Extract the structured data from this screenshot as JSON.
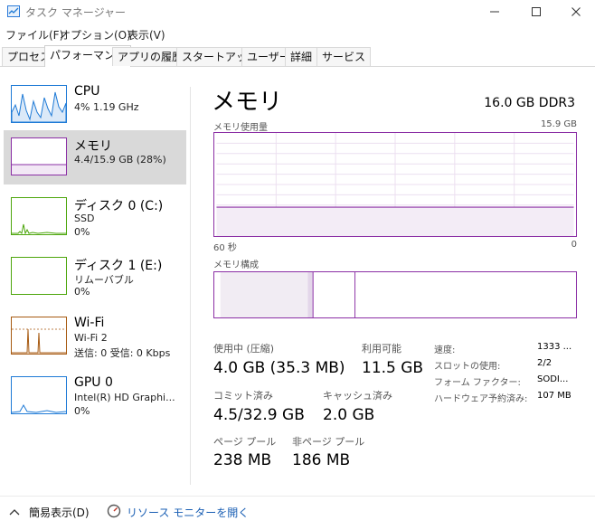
{
  "window": {
    "title": "タスク マネージャー"
  },
  "menu": [
    "ファイル(F)",
    "オプション(O)",
    "表示(V)"
  ],
  "tabs": [
    {
      "label": "プロセス",
      "active": false
    },
    {
      "label": "パフォーマンス",
      "active": true
    },
    {
      "label": "アプリの履歴",
      "active": false
    },
    {
      "label": "スタートアップ",
      "active": false
    },
    {
      "label": "ユーザー",
      "active": false
    },
    {
      "label": "詳細",
      "active": false
    },
    {
      "label": "サービス",
      "active": false
    }
  ],
  "devices": [
    {
      "name": "CPU",
      "lines": [
        "4%  1.19 GHz"
      ],
      "color": "#1e7ad6"
    },
    {
      "name": "メモリ",
      "lines": [
        "4.4/15.9 GB (28%)"
      ],
      "color": "#8b2fa5",
      "selected": true
    },
    {
      "name": "ディスク 0 (C:)",
      "lines": [
        "SSD",
        "0%"
      ],
      "color": "#4da60c"
    },
    {
      "name": "ディスク 1 (E:)",
      "lines": [
        "リムーバブル",
        "0%"
      ],
      "color": "#4da60c"
    },
    {
      "name": "Wi-Fi",
      "lines": [
        "Wi-Fi 2",
        "送信: 0 受信: 0 Kbps"
      ],
      "color": "#a75a11"
    },
    {
      "name": "GPU 0",
      "lines": [
        "Intel(R) HD Graphi...",
        "0%"
      ],
      "color": "#1e7ad6"
    }
  ],
  "memory": {
    "title": "メモリ",
    "spec": "16.0 GB DDR3",
    "usage_label": "メモリ使用量",
    "usage_max": "15.9 GB",
    "time_left": "60 秒",
    "time_right": "0",
    "composition_label": "メモリ構成",
    "usage_fraction": 0.28,
    "composition": {
      "in_use": 0.25,
      "modified": 0.015,
      "standby": 0.12
    }
  },
  "stats": {
    "in_use_label": "使用中 (圧縮)",
    "in_use_value": "4.0 GB (35.3 MB)",
    "available_label": "利用可能",
    "available_value": "11.5 GB",
    "committed_label": "コミット済み",
    "committed_value": "4.5/32.9 GB",
    "cached_label": "キャッシュ済み",
    "cached_value": "2.0 GB",
    "paged_label": "ページ プール",
    "paged_value": "238 MB",
    "nonpaged_label": "非ページ プール",
    "nonpaged_value": "186 MB"
  },
  "specs": [
    {
      "label": "速度:",
      "value": "1333 ..."
    },
    {
      "label": "スロットの使用:",
      "value": "2/2"
    },
    {
      "label": "フォーム ファクター:",
      "value": "SODI..."
    },
    {
      "label": "ハードウェア予約済み:",
      "value": "107 MB"
    }
  ],
  "footer": {
    "fewer_details": "簡易表示(D)",
    "resource_monitor": "リソース モニターを開く"
  }
}
